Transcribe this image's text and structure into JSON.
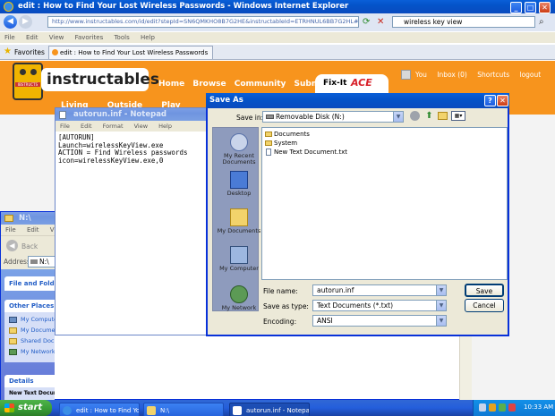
{
  "ie": {
    "title": "edit : How to Find Your Lost Wireless Passwords - Windows Internet Explorer",
    "url": "http://www.instructables.com/id/edit?stepId=SN6QMKHO8B7G2HE&instructableId=ETRHNUL6BB7G2HL#instruct",
    "search_value": "wireless key view",
    "menu": [
      "File",
      "Edit",
      "View",
      "Favorites",
      "Tools",
      "Help"
    ],
    "favorites_label": "Favorites",
    "tab_label": "edit : How to Find Your Lost Wireless Passwords"
  },
  "site": {
    "logo": "instructables",
    "robot_label": "IBSTRUCTS",
    "nav": [
      "Home",
      "Browse",
      "Community",
      "Submit"
    ],
    "fixit_label": "Fix-It",
    "ace_label": "ACE",
    "user_links": [
      "You",
      "Inbox (0)",
      "Shortcuts",
      "logout"
    ],
    "subnav": [
      "Living",
      "Outside",
      "Play"
    ]
  },
  "notepad": {
    "title": "autorun.inf - Notepad",
    "menu": [
      "File",
      "Edit",
      "Format",
      "View",
      "Help"
    ],
    "lines": [
      "[AUTORUN]",
      "Launch=wirelessKeyView.exe",
      "ACTION = Find Wireless passwords",
      "icon=wirelessKeyView.exe,0"
    ]
  },
  "explorer": {
    "title": "N:\\",
    "menu": [
      "File",
      "Edit",
      "View"
    ],
    "back_label": "Back",
    "address_label": "Address",
    "address_value": "N:\\",
    "file_folder_tasks": "File and Folder",
    "other_places": "Other Places",
    "other_items": [
      "My Compute",
      "My Documen",
      "Shared Docu",
      "My Network"
    ],
    "details": "Details",
    "details_item": "New Text Document.txt"
  },
  "saveas": {
    "title": "Save As",
    "save_in_label": "Save in:",
    "save_in_value": "Removable Disk (N:)",
    "places": [
      "My Recent Documents",
      "Desktop",
      "My Documents",
      "My Computer",
      "My Network"
    ],
    "files": [
      {
        "name": "Documents",
        "icon": "folder-icon"
      },
      {
        "name": "System",
        "icon": "folder-icon"
      },
      {
        "name": "New Text Document.txt",
        "icon": "text-file-icon"
      }
    ],
    "file_name_label": "File name:",
    "file_name_value": "autorun.inf",
    "save_type_label": "Save as type:",
    "save_type_value": "Text Documents (*.txt)",
    "encoding_label": "Encoding:",
    "encoding_value": "ANSI",
    "save_button": "Save",
    "cancel_button": "Cancel"
  },
  "taskbar": {
    "start_label": "start",
    "tasks": [
      "edit : How to Find Yo...",
      "N:\\",
      "autorun.inf - Notepad"
    ],
    "clock": "10:33 AM"
  },
  "colors": {
    "instructables_orange": "#f7941d",
    "xp_blue": "#0a5fd8",
    "start_green": "#3c9a3a"
  }
}
